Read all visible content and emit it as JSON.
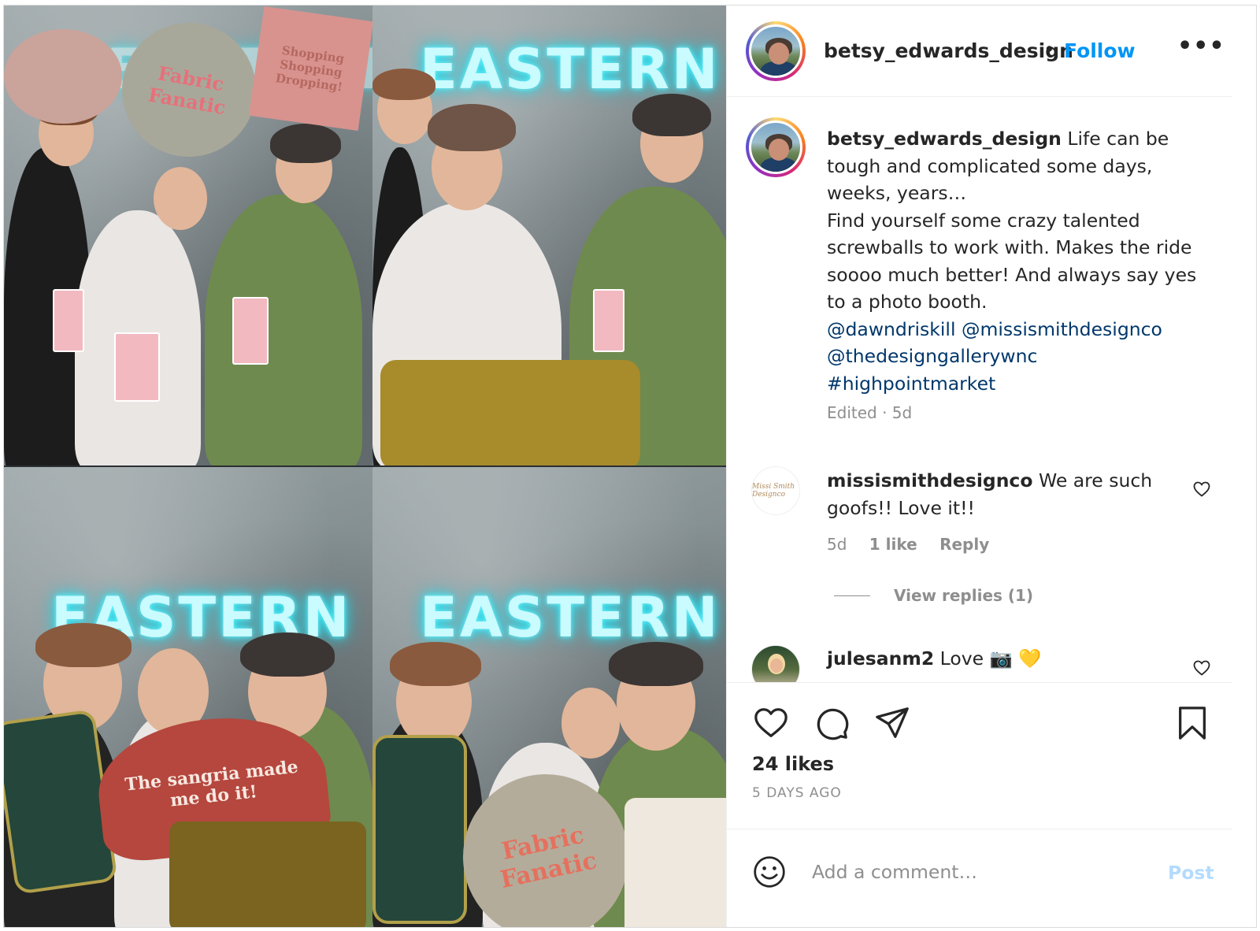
{
  "post": {
    "author": "betsy_edwards_design",
    "follow_label": "Follow",
    "separator": "•",
    "more_label": "•••"
  },
  "media": {
    "neon_text": "EASTERN",
    "pillow_texts": [
      "Fabric Fanatic",
      "Shopping Shopping Dropping!",
      "The sangria made me do it!",
      "Fabric Fanatic"
    ]
  },
  "caption": {
    "user": "betsy_edwards_design",
    "text_1": " Life can be tough and complicated some days, weeks, years…",
    "text_2": "Find yourself some crazy talented screwballs to work with. Makes the ride soooo much better! And always say yes to a photo booth.",
    "mention_1": "@dawndriskill",
    "mention_2": "@missismithdesignco",
    "mention_3": "@thedesigngallerywnc",
    "hashtag": "#highpointmarket",
    "meta": "Edited · 5d"
  },
  "comments": [
    {
      "user": "missismithdesignco",
      "text": " We are such goofs!! Love it!!",
      "age": "5d",
      "likes": "1 like",
      "reply_label": "Reply",
      "view_replies": "View replies (1)",
      "avatar_text": "Missi Smith Designco"
    },
    {
      "user": "julesanm2",
      "text": " Love 📷 💛"
    }
  ],
  "stats": {
    "likes": "24 likes",
    "posted": "5 DAYS AGO"
  },
  "add_comment": {
    "placeholder": "Add a comment…",
    "post_label": "Post"
  },
  "colors": {
    "follow": "#0095f6",
    "link": "#00376b",
    "muted": "#8e8e8e",
    "post_disabled": "#b3dbff",
    "neon": "#2fe3f3"
  },
  "icons": [
    "like-icon",
    "comment-icon",
    "share-icon",
    "save-icon",
    "emoji-icon",
    "more-icon",
    "small-heart-icon"
  ]
}
